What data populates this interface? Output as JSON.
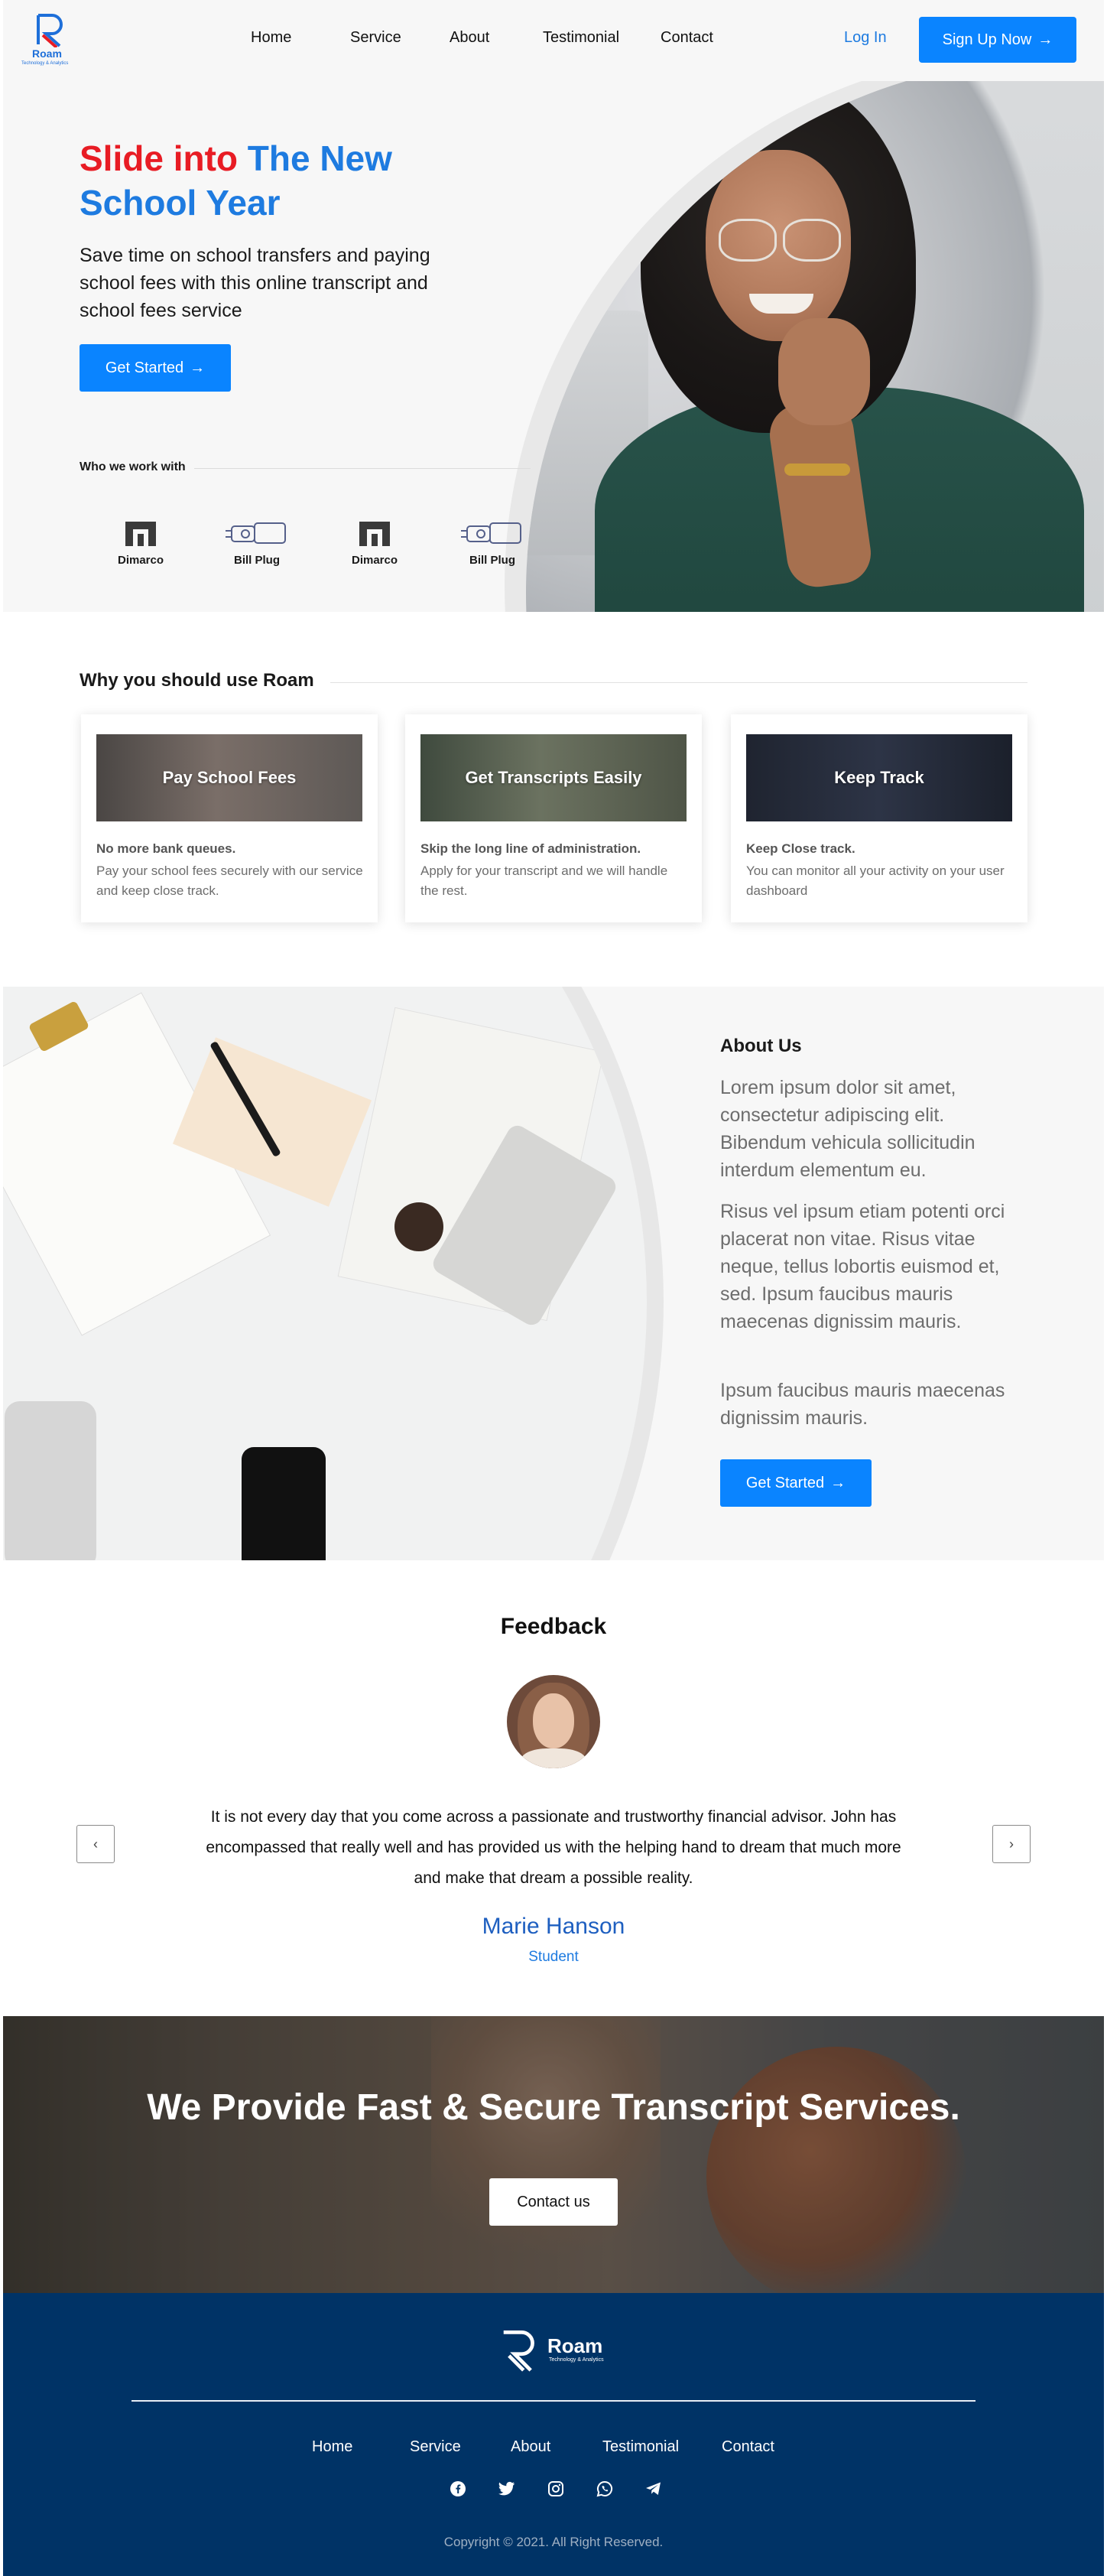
{
  "nav": {
    "logo_name": "Roam",
    "logo_tagline": "Technology & Analytics",
    "links": [
      "Home",
      "Service",
      "About",
      "Testimonial",
      "Contact"
    ],
    "login": "Log In",
    "signup": "Sign Up Now",
    "signup_arrow": "→"
  },
  "hero": {
    "title_red": "Slide into",
    "title_blue": "The New School Year",
    "subtitle": "Save time on school transfers and paying school fees with this online transcript and school fees service",
    "cta": "Get Started",
    "cta_arrow": "→",
    "partners_label": "Who we work with",
    "partners": [
      "Dimarco",
      "Bill Plug",
      "Dimarco",
      "Bill Plug"
    ]
  },
  "why": {
    "title": "Why you should use Roam",
    "cards": [
      {
        "image_label": "Pay School Fees",
        "heading": "No more bank queues.",
        "text": "Pay your school fees securely with our service and keep close track."
      },
      {
        "image_label": "Get Transcripts Easily",
        "heading": "Skip the long line of administration.",
        "text": "Apply for your transcript and we will handle the rest."
      },
      {
        "image_label": "Keep Track",
        "heading": "Keep Close track.",
        "text": "You can monitor all your activity on your user dashboard"
      }
    ]
  },
  "about": {
    "title": "About Us",
    "paragraphs": [
      "Lorem ipsum dolor sit amet, consectetur adipiscing elit. Bibendum vehicula sollicitudin interdum elementum eu.",
      "Risus vel ipsum etiam potenti orci placerat non vitae. Risus vitae neque, tellus lobortis euismod et, sed. Ipsum faucibus mauris maecenas dignissim mauris.",
      "Ipsum faucibus mauris maecenas dignissim mauris."
    ],
    "cta": "Get Started",
    "cta_arrow": "→"
  },
  "feedback": {
    "title": "Feedback",
    "quote": "It is not every day that you come across a passionate and trustworthy financial advisor. John has encompassed that really well and has provided us with the helping hand to dream that much more and make that dream a possible reality.",
    "name": "Marie Hanson",
    "role": "Student",
    "prev": "‹",
    "next": "›"
  },
  "cta_banner": {
    "title": "We Provide Fast & Secure Transcript Services.",
    "button": "Contact us"
  },
  "footer": {
    "logo_name": "Roam",
    "logo_tagline": "Technology & Analytics",
    "links": [
      "Home",
      "Service",
      "About",
      "Testimonial",
      "Contact"
    ],
    "socials": [
      "facebook-icon",
      "twitter-icon",
      "instagram-icon",
      "whatsapp-icon",
      "telegram-icon"
    ],
    "copyright": "Copyright © 2021. All Right Reserved."
  },
  "colors": {
    "primary": "#0a84ff",
    "accent_red": "#e81c24",
    "footer_bg": "#003366"
  }
}
